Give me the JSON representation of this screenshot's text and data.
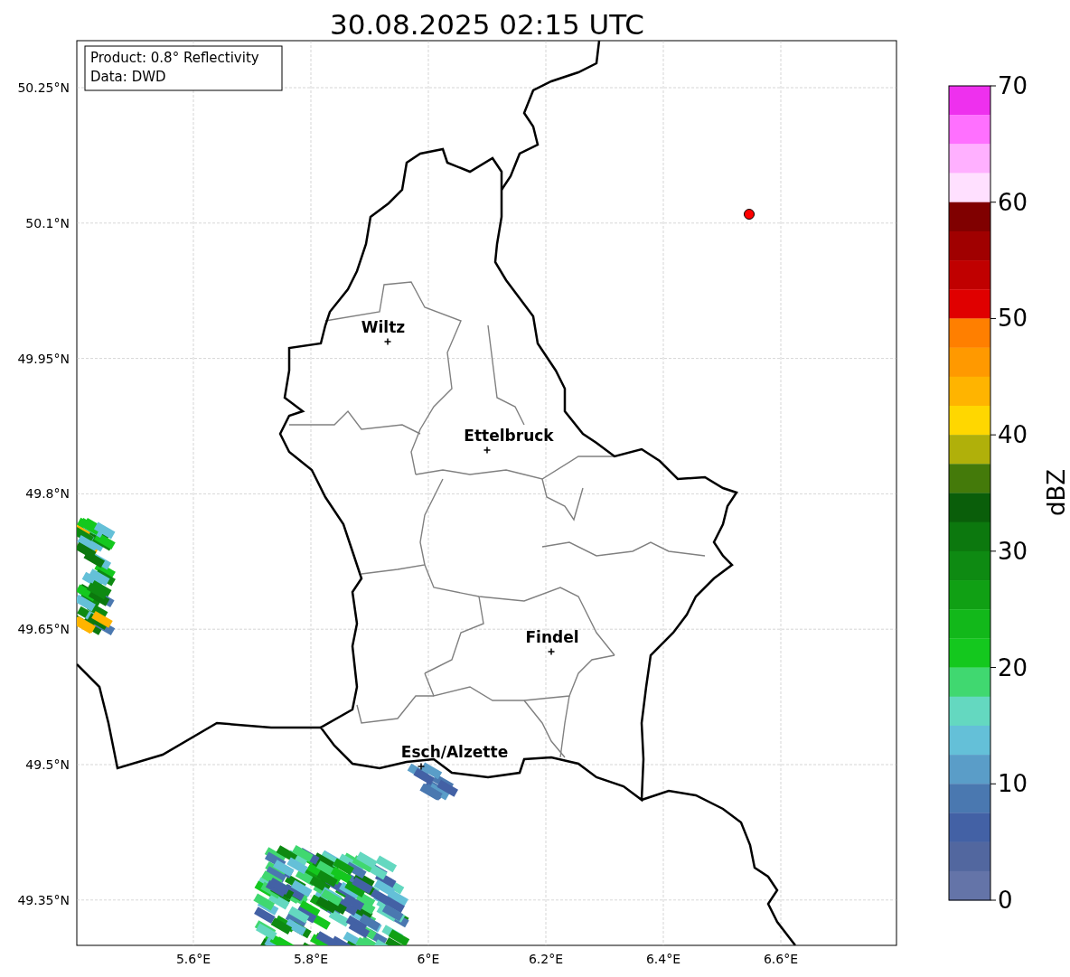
{
  "title": "30.08.2025 02:15 UTC",
  "info_box": [
    "Product: 0.8° Reflectivity",
    "Data: DWD"
  ],
  "map": {
    "x_ticks": [
      "5.6°E",
      "5.8°E",
      "6°E",
      "6.2°E",
      "6.4°E",
      "6.6°E"
    ],
    "y_ticks": [
      "50.25°N",
      "50.1°N",
      "49.95°N",
      "49.8°N",
      "49.65°N",
      "49.5°N",
      "49.35°N"
    ],
    "cities": [
      {
        "name": "Wiltz"
      },
      {
        "name": "Ettelbruck"
      },
      {
        "name": "Findel"
      },
      {
        "name": "Esch/Alzette"
      }
    ]
  },
  "colorbar": {
    "label": "dBZ",
    "ticks": [
      "70",
      "60",
      "50",
      "40",
      "30",
      "20",
      "10",
      "0"
    ],
    "bins": [
      {
        "color": "#ee30ee"
      },
      {
        "color": "#ff70ff"
      },
      {
        "color": "#ffb0ff"
      },
      {
        "color": "#ffe0ff"
      },
      {
        "color": "#800000"
      },
      {
        "color": "#a00000"
      },
      {
        "color": "#c00000"
      },
      {
        "color": "#e00000"
      },
      {
        "color": "#ff7f00"
      },
      {
        "color": "#ff9900"
      },
      {
        "color": "#ffb400"
      },
      {
        "color": "#ffd700"
      },
      {
        "color": "#b0b00a"
      },
      {
        "color": "#447a0a"
      },
      {
        "color": "#0a5e0a"
      },
      {
        "color": "#0c780e"
      },
      {
        "color": "#0e8a12"
      },
      {
        "color": "#10a014"
      },
      {
        "color": "#12b81a"
      },
      {
        "color": "#14c81e"
      },
      {
        "color": "#40d870"
      },
      {
        "color": "#64d8c0"
      },
      {
        "color": "#64c0d8"
      },
      {
        "color": "#5a9dc8"
      },
      {
        "color": "#4a78b0"
      },
      {
        "color": "#4361a5"
      },
      {
        "color": "#52679f"
      },
      {
        "color": "#6474a8"
      }
    ]
  }
}
